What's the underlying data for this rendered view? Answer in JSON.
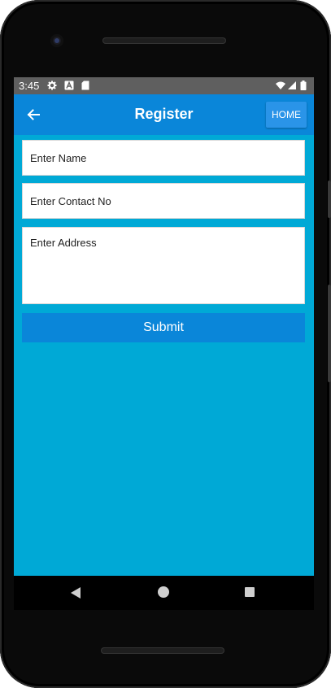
{
  "status_bar": {
    "time": "3:45"
  },
  "app_bar": {
    "title": "Register",
    "home_button_label": "HOME",
    "back_icon": "arrow-back-icon",
    "background_color": "#0a86d9"
  },
  "form": {
    "name_placeholder": "Enter Name",
    "contact_placeholder": "Enter Contact No",
    "address_placeholder": "Enter Address",
    "submit_label": "Submit",
    "background_color": "#00a9d6"
  },
  "nav_bar": {
    "back_icon": "nav-back-icon",
    "home_icon": "nav-home-icon",
    "recents_icon": "nav-recents-icon"
  }
}
